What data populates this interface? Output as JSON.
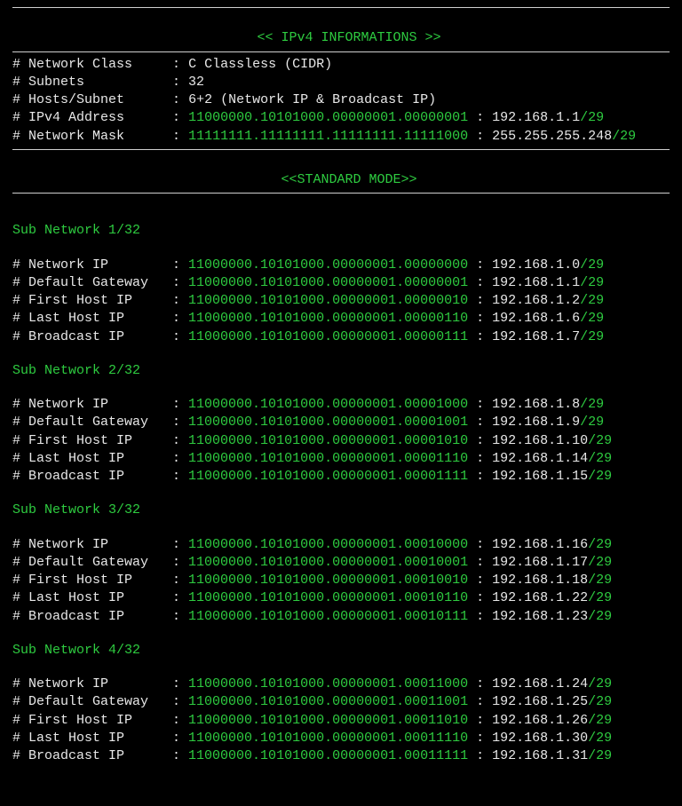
{
  "header": {
    "title_brackets_l": "<< ",
    "title_text": "IPv4 INFORMATIONS",
    "title_brackets_r": " >>"
  },
  "info": {
    "network_class_label": "# Network Class",
    "network_class_value": "C Classless (CIDR)",
    "subnets_label": "# Subnets",
    "subnets_value": "32",
    "hosts_label": "# Hosts/Subnet",
    "hosts_value": "6+2 (Network IP & Broadcast IP)",
    "ipv4_label": "# IPv4 Address",
    "ipv4_binary": "11000000.10101000.00000001.00000001",
    "ipv4_dec": "192.168.1.1",
    "ipv4_cidr": "/29",
    "mask_label": "# Network Mask",
    "mask_binary": "11111111.11111111.11111111.11111000",
    "mask_dec": "255.255.255.248",
    "mask_cidr": "/29"
  },
  "mode": {
    "brackets_l": "<<",
    "text": "STANDARD MODE",
    "brackets_r": ">>"
  },
  "labels": {
    "network_ip": "# Network IP",
    "default_gateway": "# Default Gateway",
    "first_host": "# First Host IP",
    "last_host": "# Last Host IP",
    "broadcast": "# Broadcast IP"
  },
  "cidr": "/29",
  "subnets": [
    {
      "title": "Sub Network 1/32",
      "rows": [
        {
          "k": "network_ip",
          "bin": "11000000.10101000.00000001.00000000",
          "dec": "192.168.1.0"
        },
        {
          "k": "default_gateway",
          "bin": "11000000.10101000.00000001.00000001",
          "dec": "192.168.1.1"
        },
        {
          "k": "first_host",
          "bin": "11000000.10101000.00000001.00000010",
          "dec": "192.168.1.2"
        },
        {
          "k": "last_host",
          "bin": "11000000.10101000.00000001.00000110",
          "dec": "192.168.1.6"
        },
        {
          "k": "broadcast",
          "bin": "11000000.10101000.00000001.00000111",
          "dec": "192.168.1.7"
        }
      ]
    },
    {
      "title": "Sub Network 2/32",
      "rows": [
        {
          "k": "network_ip",
          "bin": "11000000.10101000.00000001.00001000",
          "dec": "192.168.1.8"
        },
        {
          "k": "default_gateway",
          "bin": "11000000.10101000.00000001.00001001",
          "dec": "192.168.1.9"
        },
        {
          "k": "first_host",
          "bin": "11000000.10101000.00000001.00001010",
          "dec": "192.168.1.10"
        },
        {
          "k": "last_host",
          "bin": "11000000.10101000.00000001.00001110",
          "dec": "192.168.1.14"
        },
        {
          "k": "broadcast",
          "bin": "11000000.10101000.00000001.00001111",
          "dec": "192.168.1.15"
        }
      ]
    },
    {
      "title": "Sub Network 3/32",
      "rows": [
        {
          "k": "network_ip",
          "bin": "11000000.10101000.00000001.00010000",
          "dec": "192.168.1.16"
        },
        {
          "k": "default_gateway",
          "bin": "11000000.10101000.00000001.00010001",
          "dec": "192.168.1.17"
        },
        {
          "k": "first_host",
          "bin": "11000000.10101000.00000001.00010010",
          "dec": "192.168.1.18"
        },
        {
          "k": "last_host",
          "bin": "11000000.10101000.00000001.00010110",
          "dec": "192.168.1.22"
        },
        {
          "k": "broadcast",
          "bin": "11000000.10101000.00000001.00010111",
          "dec": "192.168.1.23"
        }
      ]
    },
    {
      "title": "Sub Network 4/32",
      "rows": [
        {
          "k": "network_ip",
          "bin": "11000000.10101000.00000001.00011000",
          "dec": "192.168.1.24"
        },
        {
          "k": "default_gateway",
          "bin": "11000000.10101000.00000001.00011001",
          "dec": "192.168.1.25"
        },
        {
          "k": "first_host",
          "bin": "11000000.10101000.00000001.00011010",
          "dec": "192.168.1.26"
        },
        {
          "k": "last_host",
          "bin": "11000000.10101000.00000001.00011110",
          "dec": "192.168.1.30"
        },
        {
          "k": "broadcast",
          "bin": "11000000.10101000.00000001.00011111",
          "dec": "192.168.1.31"
        }
      ]
    }
  ]
}
